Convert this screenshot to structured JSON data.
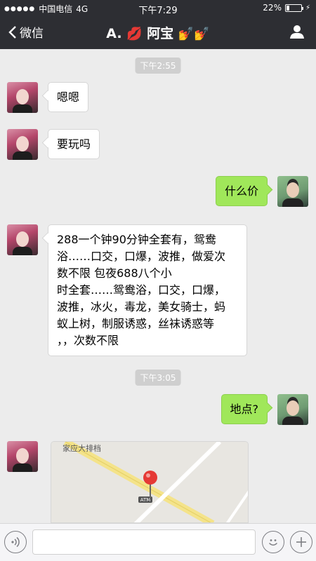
{
  "status": {
    "signal_dots": "●●●●●",
    "carrier": "中国电信",
    "network": "4G",
    "time": "下午7:29",
    "battery_percent": "22%",
    "battery_level": 0.22
  },
  "nav": {
    "back_label": "微信",
    "title_name_1": "A.",
    "title_name_2": "阿宝",
    "title_emoji_lips": "💋",
    "title_emoji_nails_1": "💅",
    "title_emoji_nails_2": "💅"
  },
  "messages": {
    "ts1": "下午2:55",
    "m1": "嗯嗯",
    "m2": "要玩吗",
    "m3": "什么价",
    "m4": "288一个钟90分钟全套有，鸳鸯\n浴……口交，口爆，波推，做爱次\n数不限                包夜688八个小\n时全套……鸳鸯浴，口交，口爆，\n波推，冰火，毒龙，美女骑士，蚂\n蚁上树，制服诱惑，丝袜诱惑等\n，，次数不限",
    "ts2": "下午3:05",
    "m5": "地点?",
    "map_label": "家应大排档",
    "map_marker": "ATM"
  },
  "input": {
    "placeholder": ""
  },
  "colors": {
    "nav_bg": "#2d2e33",
    "chat_bg": "#ececec",
    "outgoing_bubble": "#a0e75a",
    "incoming_bubble": "#ffffff",
    "pin_red": "#e53935"
  }
}
